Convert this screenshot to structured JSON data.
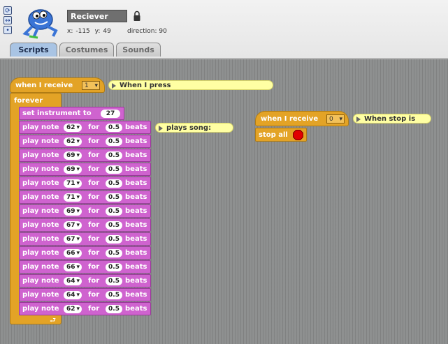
{
  "header": {
    "sprite_name": "Reciever",
    "x_label": "x:",
    "x_value": "-115",
    "y_label": "y:",
    "y_value": "49",
    "direction_label": "direction:",
    "direction_value": "90"
  },
  "tabs": [
    {
      "label": "Scripts",
      "active": true
    },
    {
      "label": "Costumes",
      "active": false
    },
    {
      "label": "Sounds",
      "active": false
    }
  ],
  "script1": {
    "hat_label": "when I receive",
    "hat_value": "1",
    "comment": "When I press",
    "forever_label": "forever",
    "set_instrument_label": "set instrument to",
    "instrument_value": "27",
    "comment2": "plays song:",
    "play_label": "play note",
    "for_label": "for",
    "beats_label": "beats",
    "beat_value": "0.5",
    "notes": [
      "62",
      "62",
      "69",
      "69",
      "71",
      "71",
      "69",
      "67",
      "67",
      "66",
      "66",
      "64",
      "64",
      "62"
    ]
  },
  "script2": {
    "hat_label": "when I receive",
    "hat_value": "0",
    "comment": "When stop is",
    "stop_label": "stop all"
  },
  "colors": {
    "control": "#e3a326",
    "sound": "#cf63cf",
    "comment": "#ffffa3",
    "tab_active": "#a9c4e4"
  }
}
